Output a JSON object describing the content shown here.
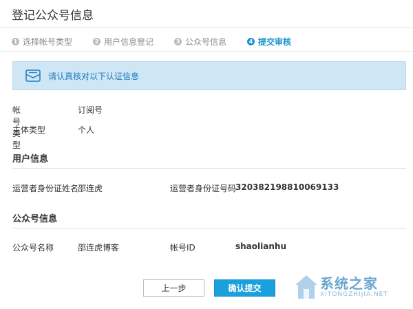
{
  "header": {
    "title": "登记公众号信息"
  },
  "steps": [
    {
      "num": "1",
      "label": "选择帐号类型",
      "active": false
    },
    {
      "num": "2",
      "label": "用户信息登记",
      "active": false
    },
    {
      "num": "3",
      "label": "公众号信息",
      "active": false
    },
    {
      "num": "4",
      "label": "提交审核",
      "active": true
    }
  ],
  "notice": {
    "text": "请认真核对以下认证信息",
    "icon": "envelope-icon"
  },
  "account": {
    "type_label": "帐号类型",
    "type_value": "订阅号",
    "subject_label": "主体类型",
    "subject_value": "个人"
  },
  "user_info": {
    "heading": "用户信息",
    "name_label": "运营者身份证姓名",
    "name_value": "邵连虎",
    "id_label": "运营者身份证号码",
    "id_value": "320382198810069133"
  },
  "mp_info": {
    "heading": "公众号信息",
    "name_label": "公众号名称",
    "name_value": "邵连虎博客",
    "id_label": "帐号ID",
    "id_value": "shaolianhu"
  },
  "buttons": {
    "prev": "上一步",
    "confirm": "确认提交"
  },
  "watermark": {
    "text": "系统之家",
    "sub": "XITONGZHIJIA.NET"
  },
  "colors": {
    "accent": "#1b93cc",
    "notice_bg": "#cfe6f5",
    "button": "#1aa0dd"
  }
}
